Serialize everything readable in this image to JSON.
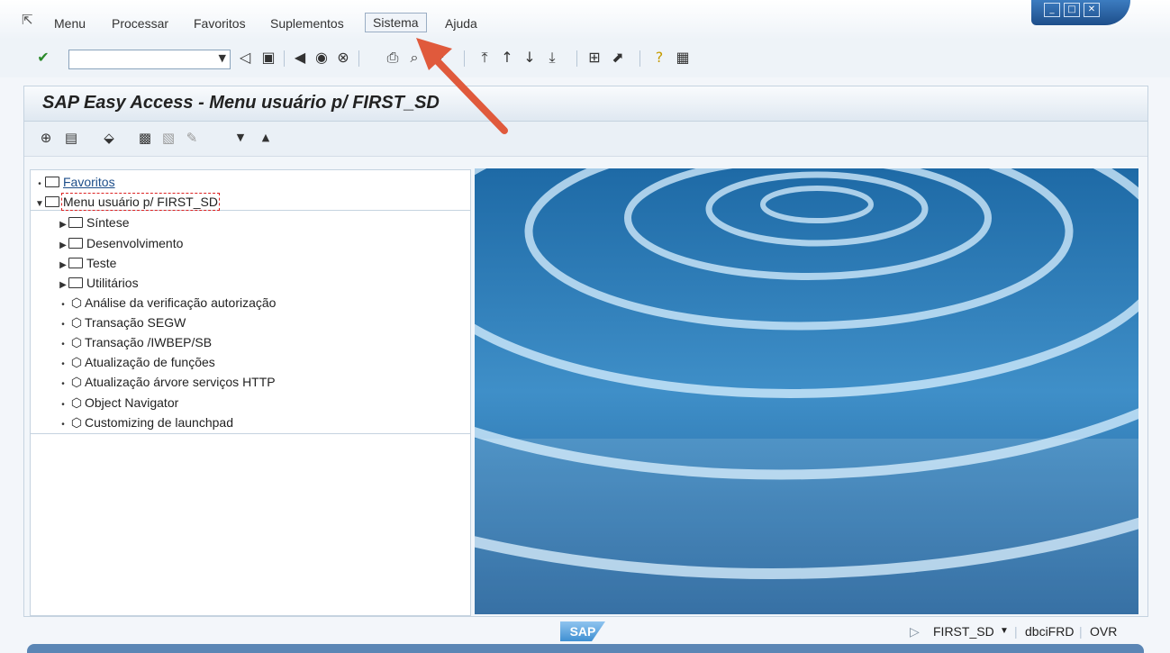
{
  "menubar": {
    "items": [
      "Menu",
      "Processar",
      "Favoritos",
      "Suplementos",
      "Sistema",
      "Ajuda"
    ],
    "active": "Sistema"
  },
  "window": {
    "title": "SAP Easy Access  -  Menu usuário p/ FIRST_SD"
  },
  "tree": {
    "root_favoritos": "Favoritos",
    "root_menu": "Menu usuário p/ FIRST_SD",
    "folders": [
      "Síntese",
      "Desenvolvimento",
      "Teste",
      "Utilitários"
    ],
    "transactions": [
      "Análise da verificação autorização",
      "Transação SEGW",
      "Transação /IWBEP/SB",
      "Atualização de funções",
      "Atualização árvore serviços HTTP",
      "Object Navigator",
      "Customizing de launchpad"
    ]
  },
  "statusbar": {
    "logo": "SAP",
    "user": "FIRST_SD",
    "host": "dbciFRD",
    "mode": "OVR"
  },
  "colors": {
    "accent": "#1d4e8a",
    "arrow": "#e05a3c"
  }
}
